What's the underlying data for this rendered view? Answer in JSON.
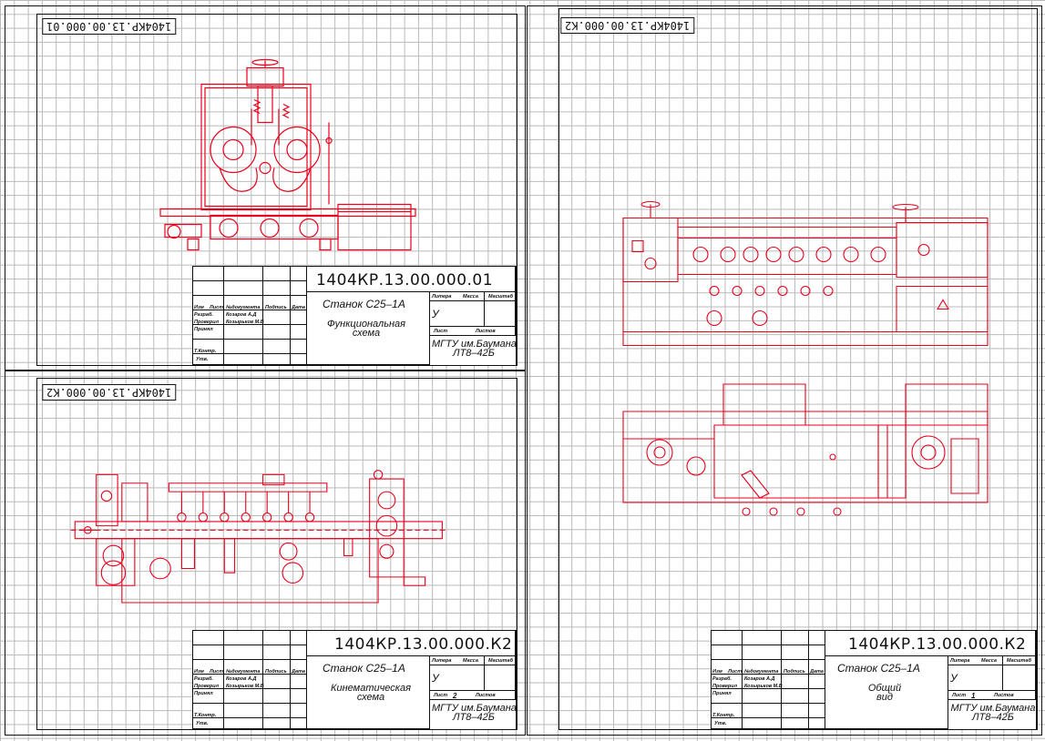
{
  "colors": {
    "drawing": "#e8001c",
    "frame": "#111111",
    "grid": "#b9b9b9"
  },
  "sheets": [
    {
      "id": "functional",
      "stamp_code": "1404КР.13.00.000.01",
      "title_block": {
        "code": "1404КР.13.00.000.01",
        "machine": "Станок С25–1А",
        "doc_title": "Функциональная схема",
        "org": "МГТУ им.Баумана",
        "group": "ЛТ8–42Б",
        "letter": "У",
        "sheet_no": "",
        "headers": {
          "izm": "Изм",
          "list": "Лист",
          "doc": "№документа",
          "sign": "Подпись",
          "date": "Дата",
          "litera": "Литера",
          "mass": "Масса",
          "scale": "Масштаб",
          "sheet": "Лист",
          "sheets": "Листов"
        },
        "rows": {
          "dev": "Разраб.",
          "dev_name": "Козаров А.Д",
          "check": "Проверил",
          "check_name": "Козырьков М.В",
          "approved": "Принял",
          "tcontrol": "Т.Контр.",
          "utv": "Утв."
        }
      }
    },
    {
      "id": "kinematic",
      "stamp_code": "1404КР.13.00.000.К2",
      "title_block": {
        "code": "1404КР.13.00.000.К2",
        "machine": "Станок С25–1А",
        "doc_title": "Кинематическая схема",
        "org": "МГТУ им.Баумана",
        "group": "ЛТ8–42Б",
        "letter": "У",
        "sheet_no": "2",
        "headers": {
          "izm": "Изм",
          "list": "Лист",
          "doc": "№документа",
          "sign": "Подпись",
          "date": "Дата",
          "litera": "Литера",
          "mass": "Масса",
          "scale": "Масштаб",
          "sheet": "Лист",
          "sheets": "Листов"
        },
        "rows": {
          "dev": "Разраб.",
          "dev_name": "Козаров А.Д",
          "check": "Проверил",
          "check_name": "Козырьков М.В",
          "approved": "Принял",
          "tcontrol": "Т.Контр.",
          "utv": "Утв."
        }
      }
    },
    {
      "id": "general",
      "stamp_code": "1404КР.13.00.000.К2",
      "title_block": {
        "code": "1404КР.13.00.000.К2",
        "machine": "Станок С25–1А",
        "doc_title": "Общий вид",
        "org": "МГТУ им.Баумана",
        "group": "ЛТ8–42Б",
        "letter": "У",
        "sheet_no": "1",
        "headers": {
          "izm": "Изм",
          "list": "Лист",
          "doc": "№документа",
          "sign": "Подпись",
          "date": "Дата",
          "litera": "Литера",
          "mass": "Масса",
          "scale": "Масштаб",
          "sheet": "Лист",
          "sheets": "Листов"
        },
        "rows": {
          "dev": "Разраб.",
          "dev_name": "Козаров А.Д",
          "check": "Проверил",
          "check_name": "Козырьков М.В",
          "approved": "Принял",
          "tcontrol": "Т.Контр.",
          "utv": "Утв."
        }
      }
    }
  ]
}
